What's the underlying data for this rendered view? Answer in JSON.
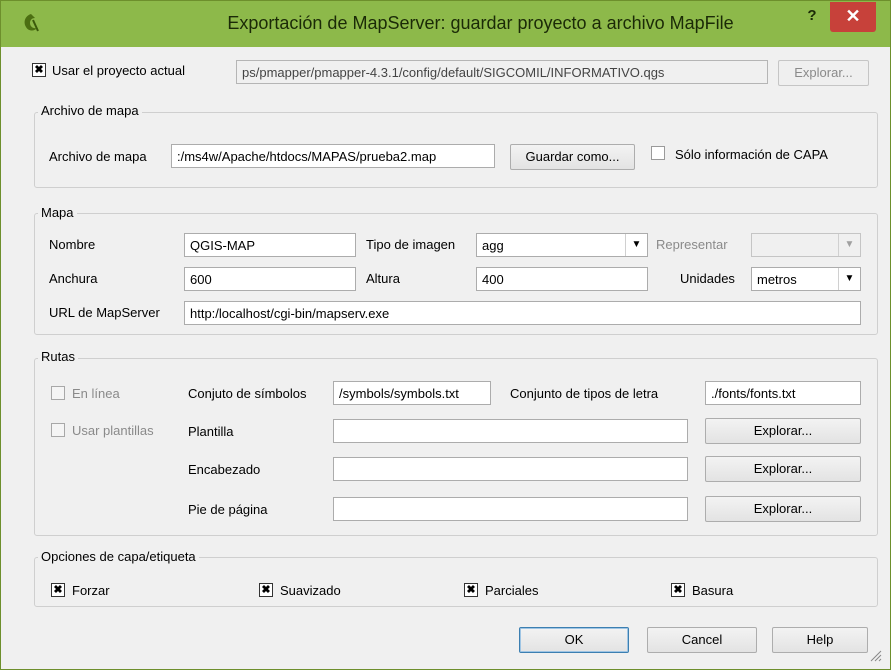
{
  "window": {
    "title": "Exportación de MapServer: guardar proyecto a archivo MapFile",
    "help_glyph": "?",
    "close_glyph": "✕"
  },
  "project": {
    "use_current_label": "Usar el proyecto actual",
    "use_current_checked": true,
    "path": "ps/pmapper/pmapper-4.3.1/config/default/SIGCOMIL/INFORMATIVO.qgs",
    "browse_label": "Explorar..."
  },
  "map_file": {
    "group_title": "Archivo de mapa",
    "label": "Archivo de mapa",
    "path": ":/ms4w/Apache/htdocs/MAPAS/prueba2.map",
    "save_as_label": "Guardar como...",
    "layer_info_only_label": "Sólo información de CAPA",
    "layer_info_only_checked": false
  },
  "map": {
    "group_title": "Mapa",
    "name_label": "Nombre",
    "name_value": "QGIS-MAP",
    "image_type_label": "Tipo de imagen",
    "image_type_value": "agg",
    "render_label": "Representar",
    "render_value": "",
    "width_label": "Anchura",
    "width_value": "600",
    "height_label": "Altura",
    "height_value": "400",
    "units_label": "Unidades",
    "units_value": "metros",
    "url_label": "URL de MapServer",
    "url_value": "http:/localhost/cgi-bin/mapserv.exe"
  },
  "paths": {
    "group_title": "Rutas",
    "online_label": "En línea",
    "use_templates_label": "Usar plantillas",
    "symbols_label": "Conjuto de símbolos",
    "symbols_value": "/symbols/symbols.txt",
    "fonts_label": "Conjunto de tipos de letra",
    "fonts_value": "./fonts/fonts.txt",
    "template_label": "Plantilla",
    "template_value": "",
    "header_label": "Encabezado",
    "header_value": "",
    "footer_label": "Pie de página",
    "footer_value": "",
    "browse_label": "Explorar..."
  },
  "layer_options": {
    "group_title": "Opciones de capa/etiqueta",
    "force_label": "Forzar",
    "antialias_label": "Suavizado",
    "partials_label": "Parciales",
    "dump_label": "Basura",
    "force_checked": true,
    "antialias_checked": true,
    "partials_checked": true,
    "dump_checked": true
  },
  "footer_buttons": {
    "ok": "OK",
    "cancel": "Cancel",
    "help": "Help"
  },
  "check_glyph": "✖",
  "dropdown_glyph": "▼"
}
